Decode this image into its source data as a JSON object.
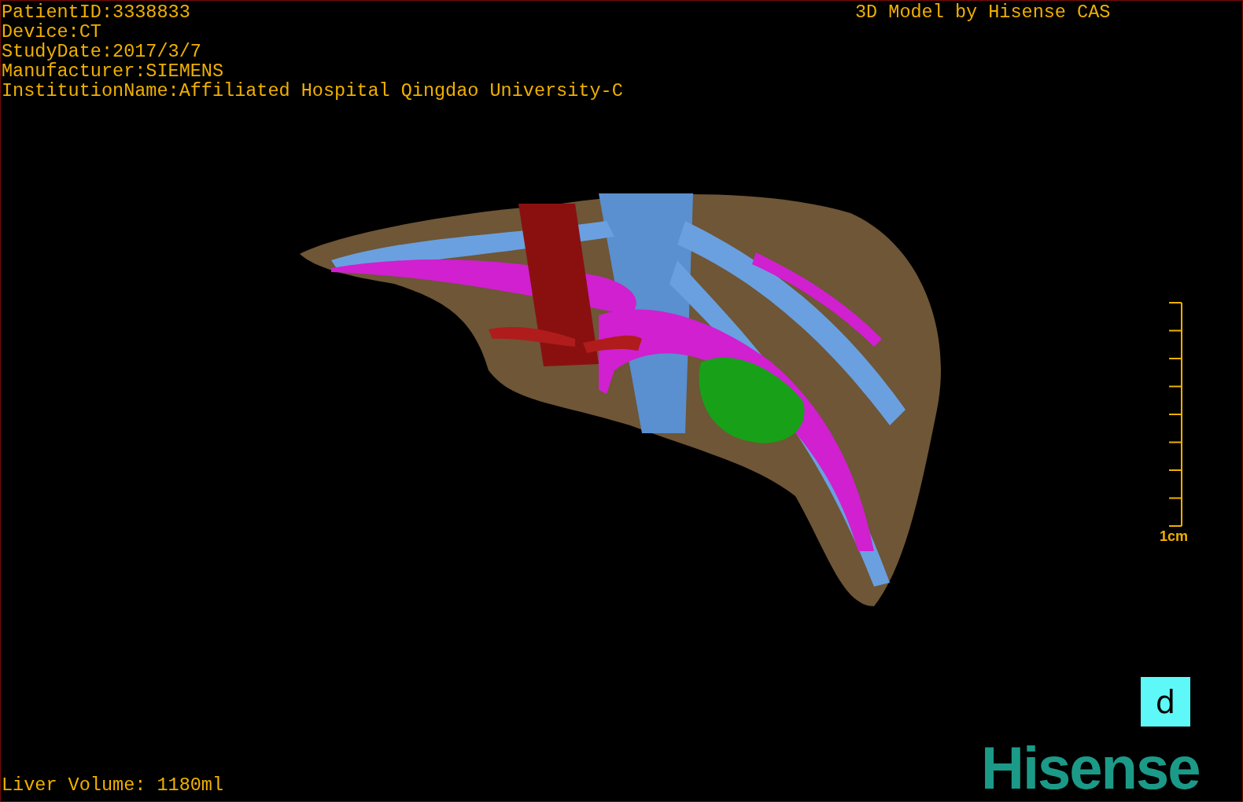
{
  "info_lines": [
    "PatientID:3338833",
    "Device:CT",
    "StudyDate:2017/3/7",
    "Manufacturer:SIEMENS",
    "InstitutionName:Affiliated Hospital Qingdao University-C"
  ],
  "title": "3D Model by Hisense CAS",
  "scale_bar": {
    "label": "1cm"
  },
  "view_badge": "d",
  "liver_volume": "Liver Volume: 1180ml",
  "logo": "Hisense"
}
